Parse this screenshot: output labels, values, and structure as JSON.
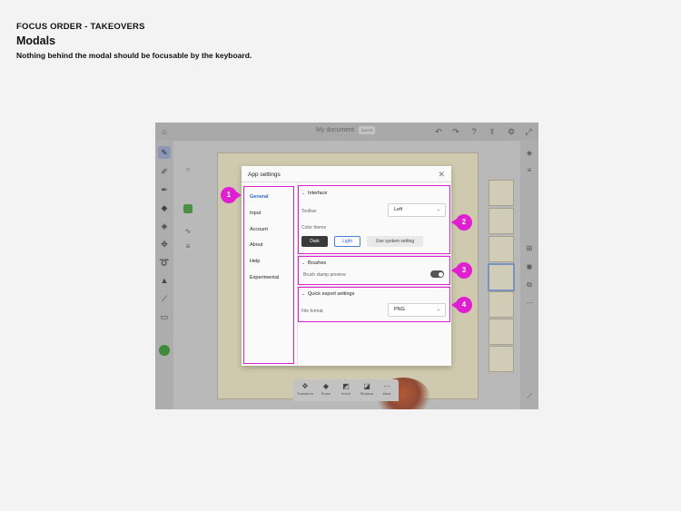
{
  "header": {
    "eyebrow": "FOCUS ORDER - TAKEOVERS",
    "title": "Modals",
    "subtitle": "Nothing behind the modal should be focusable by the keyboard."
  },
  "app": {
    "document_title": "My document",
    "document_badge": "Saved",
    "bottom_bar": [
      "Transform",
      "Erase",
      "Invert",
      "Shadow",
      "More"
    ]
  },
  "modal": {
    "title": "App settings",
    "nav": [
      "General",
      "Input",
      "Account",
      "About",
      "Help",
      "Experimental"
    ],
    "interface": {
      "title": "Interface",
      "toolbar_label": "Toolbar",
      "toolbar_value": "Left",
      "color_theme_label": "Color theme",
      "themes": [
        "Dark",
        "Light",
        "Use system setting"
      ]
    },
    "brushes": {
      "title": "Brushes",
      "stamp_label": "Brush stamp preview"
    },
    "export": {
      "title": "Quick export settings",
      "format_label": "File format",
      "format_value": "PNG"
    }
  },
  "badges": [
    "1",
    "2",
    "3",
    "4"
  ],
  "colors": {
    "highlight": "#e020d0",
    "active_nav": "#2c63c8"
  }
}
